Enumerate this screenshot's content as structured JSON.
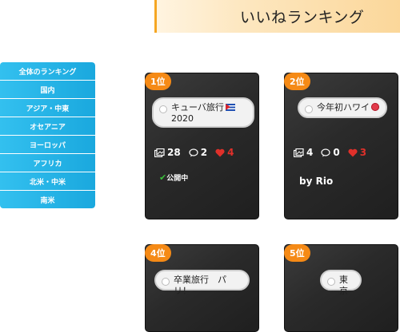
{
  "page": {
    "title": "いいねランキング"
  },
  "sidebar": {
    "items": [
      {
        "label": "全体のランキング"
      },
      {
        "label": "国内"
      },
      {
        "label": "アジア・中東"
      },
      {
        "label": "オセアニア"
      },
      {
        "label": "ヨーロッパ"
      },
      {
        "label": "アフリカ"
      },
      {
        "label": "北米・中米"
      },
      {
        "label": "南米"
      }
    ]
  },
  "cards": [
    {
      "rank": "1位",
      "name": "キューバ旅行",
      "name_line2": "2020",
      "photos": "28",
      "comments": "2",
      "likes": "4",
      "status": "公開中",
      "byline": ""
    },
    {
      "rank": "2位",
      "name": "今年初ハワイ",
      "photos": "4",
      "comments": "0",
      "likes": "3",
      "byline": "by Rio"
    },
    {
      "rank": "4位",
      "name": "卒業旅行　パリ！"
    },
    {
      "rank": "5位",
      "name": "東京"
    }
  ],
  "colors": {
    "accent": "#f58a16",
    "sidebar": "#1aa8de",
    "like": "#e0302a",
    "public": "#3bbf3b"
  }
}
